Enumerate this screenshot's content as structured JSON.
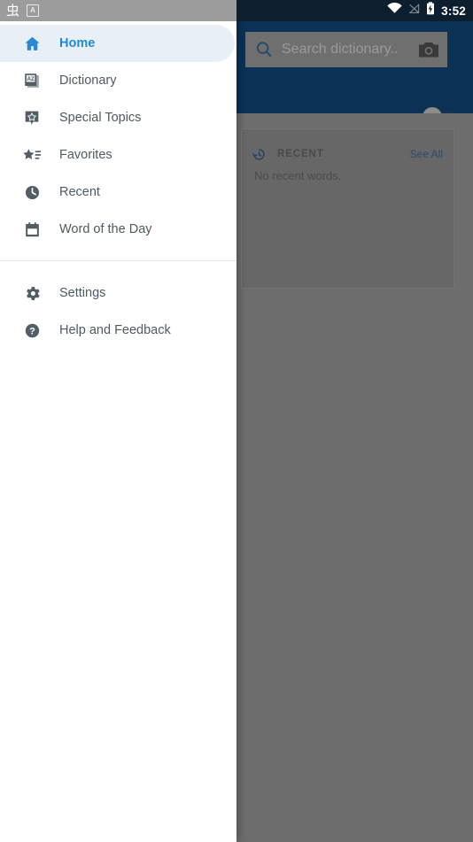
{
  "status_bar": {
    "left_icons": [
      {
        "name": "ime-glyph-icon",
        "glyph": "虫"
      },
      {
        "name": "keyboard-language-icon",
        "glyph": "A"
      }
    ],
    "right_icons": [
      {
        "name": "wifi-icon"
      },
      {
        "name": "mobile-signal-off-icon"
      },
      {
        "name": "battery-charging-icon"
      }
    ],
    "time": "3:52"
  },
  "drawer": {
    "items": [
      {
        "label": "Home",
        "icon": "home-icon",
        "selected": true
      },
      {
        "label": "Dictionary",
        "icon": "dictionary-book-icon",
        "selected": false
      },
      {
        "label": "Special Topics",
        "icon": "special-topics-star-bubble-icon",
        "selected": false
      },
      {
        "label": "Favorites",
        "icon": "favorites-star-list-icon",
        "selected": false
      },
      {
        "label": "Recent",
        "icon": "recent-clock-icon",
        "selected": false
      },
      {
        "label": "Word of the Day",
        "icon": "calendar-icon",
        "selected": false
      }
    ],
    "footer_items": [
      {
        "label": "Settings",
        "icon": "gear-icon"
      },
      {
        "label": "Help and Feedback",
        "icon": "help-circle-icon"
      }
    ],
    "accent_color": "#2089d6",
    "selected_background": "#e8eff5"
  },
  "app": {
    "header_color": "#0b3255",
    "search": {
      "placeholder": "Search dictionary..",
      "value": "",
      "search_icon": "search-icon",
      "camera_icon": "camera-icon"
    },
    "toggle": {
      "name": "header-toggle-switch",
      "state": "off"
    },
    "recent_card": {
      "icon": "history-icon",
      "title": "RECENT",
      "see_all_label": "See All",
      "empty_message": "No recent words."
    }
  }
}
